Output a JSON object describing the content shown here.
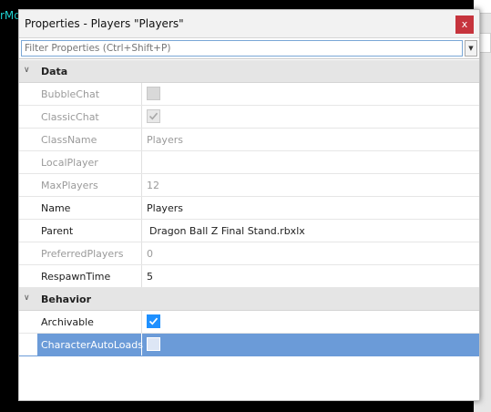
{
  "background": {
    "text": "rMo"
  },
  "window": {
    "title": "Properties - Players \"Players\"",
    "close_label": "x"
  },
  "filter": {
    "placeholder": "Filter Properties (Ctrl+Shift+P)",
    "dropdown_icon": "chevron-down-icon"
  },
  "sections": [
    {
      "label": "Data",
      "properties": [
        {
          "name": "BubbleChat",
          "type": "checkbox",
          "checked": false,
          "readonly": true
        },
        {
          "name": "ClassicChat",
          "type": "checkbox",
          "checked": true,
          "readonly": true
        },
        {
          "name": "ClassName",
          "value": "Players",
          "readonly": true
        },
        {
          "name": "LocalPlayer",
          "value": "",
          "readonly": true
        },
        {
          "name": "MaxPlayers",
          "value": "12",
          "readonly": true
        },
        {
          "name": "Name",
          "value": "Players",
          "readonly": false
        },
        {
          "name": "Parent",
          "value": "Dragon Ball Z Final Stand.rbxlx",
          "readonly": false
        },
        {
          "name": "PreferredPlayers",
          "value": "0",
          "readonly": true
        },
        {
          "name": "RespawnTime",
          "value": "5",
          "readonly": false
        }
      ]
    },
    {
      "label": "Behavior",
      "properties": [
        {
          "name": "Archivable",
          "type": "checkbox",
          "checked": true,
          "readonly": false
        },
        {
          "name": "CharacterAutoLoads",
          "type": "checkbox",
          "checked": false,
          "readonly": false,
          "selected": true
        }
      ]
    }
  ],
  "colors": {
    "accent": "#1e90ff",
    "selection": "#6b9bd8",
    "close": "#c6343d"
  }
}
